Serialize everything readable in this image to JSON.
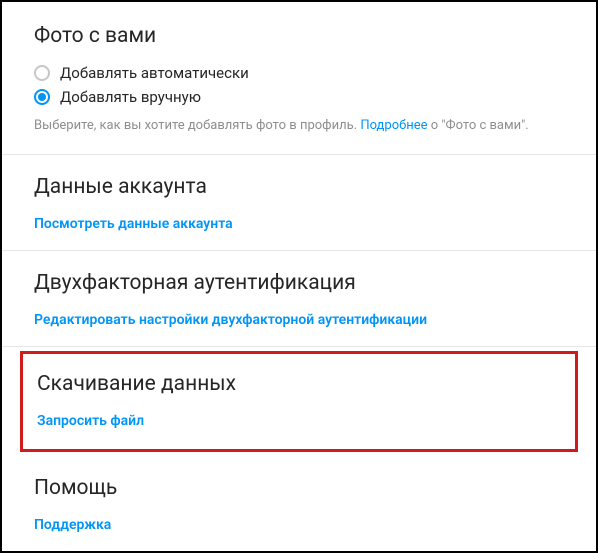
{
  "photos": {
    "title": "Фото с вами",
    "option_auto": "Добавлять автоматически",
    "option_manual": "Добавлять вручную",
    "hint_prefix": "Выберите, как вы хотите добавлять фото в профиль. ",
    "hint_link": "Подробнее",
    "hint_suffix": " о \"Фото с вами\"."
  },
  "account": {
    "title": "Данные аккаунта",
    "link": "Посмотреть данные аккаунта"
  },
  "twofa": {
    "title": "Двухфакторная аутентификация",
    "link": "Редактировать настройки двухфакторной аутентификации"
  },
  "download": {
    "title": "Скачивание данных",
    "link": "Запросить файл"
  },
  "help": {
    "title": "Помощь",
    "link": "Поддержка"
  }
}
